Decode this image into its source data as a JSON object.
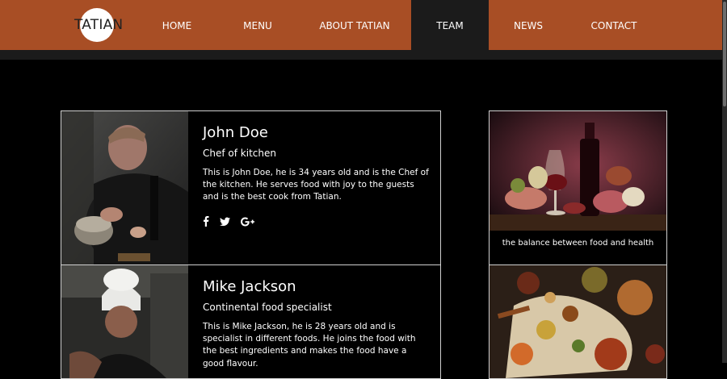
{
  "logo": {
    "text": "TATIAN"
  },
  "nav": {
    "items": [
      {
        "label": "HOME",
        "active": false
      },
      {
        "label": "MENU",
        "active": false
      },
      {
        "label": "ABOUT TATIAN",
        "active": false
      },
      {
        "label": "TEAM",
        "active": true
      },
      {
        "label": "NEWS",
        "active": false
      },
      {
        "label": "CONTACT",
        "active": false
      }
    ]
  },
  "team": [
    {
      "name": "John Doe",
      "role": "Chef of kitchen",
      "description": "This is John Doe, he is 34 years old and is the Chef of the kitchen. He serves food with joy to the guests and is the best cook from Tatian.",
      "socials": [
        "facebook-icon",
        "twitter-icon",
        "google-plus-icon"
      ]
    },
    {
      "name": "Mike Jackson",
      "role": "Continental food specialist",
      "description": "This is Mike Jackson, he is 28 years old and is specialist in different foods. He joins the food with the best ingredients and makes the food have a good flavour."
    }
  ],
  "sidebar": {
    "cards": [
      {
        "caption": "the balance between food and health"
      },
      {
        "caption": ""
      }
    ]
  },
  "colors": {
    "brand": "#a84e25",
    "active_nav": "#1b1b1b",
    "background": "#000000"
  }
}
